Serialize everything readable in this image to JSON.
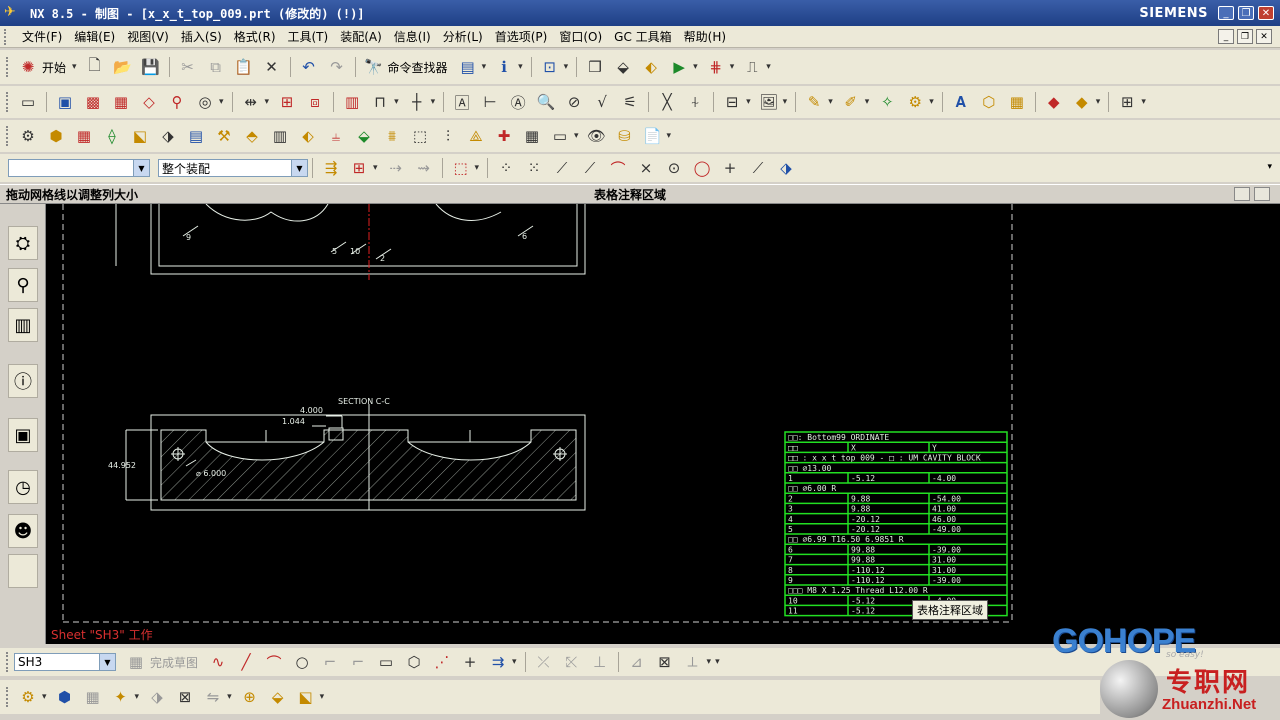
{
  "window": {
    "title": "NX 8.5 - 制图 - [x_x_t_top_009.prt (修改的)     (!)]",
    "brand": "SIEMENS",
    "controls": [
      "minimize",
      "restore",
      "close"
    ]
  },
  "menu": [
    "文件(F)",
    "编辑(E)",
    "视图(V)",
    "插入(S)",
    "格式(R)",
    "工具(T)",
    "装配(A)",
    "信息(I)",
    "分析(L)",
    "首选项(P)",
    "窗口(O)",
    "GC 工具箱",
    "帮助(H)"
  ],
  "toolbar1": {
    "start_label": "开始",
    "finder_label": "命令查找器"
  },
  "selection": {
    "filter_value": "",
    "scope_value": "整个装配"
  },
  "infobar": {
    "hint": "拖动网格线以调整列大小",
    "center": "表格注释区域"
  },
  "drawing": {
    "section_label": "SECTION C-C",
    "dim_4000": "4.000",
    "dim_1044": "1.044",
    "dim_44952": "44.952",
    "dia_label": "⌀ 6.000",
    "num5": "5",
    "num10": "10",
    "num2": "2",
    "num9": "9",
    "num6": "6"
  },
  "table": {
    "rows": [
      [
        "□□: Bottom99 ORDINATE",
        ""
      ],
      [
        "□□",
        "X",
        "Y"
      ],
      [
        "□□ : x_x_t_top_009 - □ : UM_CAVITY_BLOCK"
      ],
      [
        "□□ ⌀13.00"
      ],
      [
        "1",
        "-5.12",
        "-4.00"
      ],
      [
        "□□ ⌀6.00 R"
      ],
      [
        "2",
        "9.88",
        "-54.00"
      ],
      [
        "3",
        "9.88",
        "41.00"
      ],
      [
        "4",
        "-20.12",
        "46.00"
      ],
      [
        "5",
        "-20.12",
        "-49.00"
      ],
      [
        "□□ ⌀6.99 T16.50 6.9851 R"
      ],
      [
        "6",
        "99.88",
        "-39.00"
      ],
      [
        "7",
        "99.88",
        "31.00"
      ],
      [
        "8",
        "-110.12",
        "31.00"
      ],
      [
        "9",
        "-110.12",
        "-39.00"
      ],
      [
        "□□□ M8_X_1.25 Thread_L12.00 R"
      ],
      [
        "10",
        "-5.12",
        "-4.00"
      ],
      [
        "11",
        "-5.12",
        "41.00"
      ]
    ]
  },
  "tooltip": "表格注释区域",
  "sheet_label": "Sheet \"SH3\" 工作",
  "bottom": {
    "sheet_combo": "SH3",
    "finish_sketch": "完成草图"
  },
  "watermark": {
    "gohope": "GOHOPE",
    "cn": "专职网",
    "en": "Zhuanzhi.Net",
    "tag": "so easy!"
  },
  "colors": {
    "title_bg": "#1e3f85",
    "canvas_bg": "#000000",
    "table_green": "#22e022",
    "sheet_label": "#d83030"
  }
}
